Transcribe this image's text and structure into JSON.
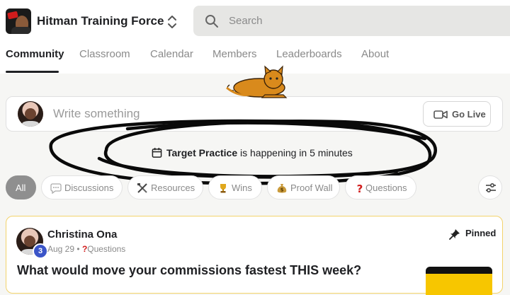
{
  "header": {
    "group_name": "Hitman Training Force",
    "search_placeholder": "Search"
  },
  "tabs": [
    {
      "label": "Community",
      "active": true
    },
    {
      "label": "Classroom",
      "active": false
    },
    {
      "label": "Calendar",
      "active": false
    },
    {
      "label": "Members",
      "active": false
    },
    {
      "label": "Leaderboards",
      "active": false
    },
    {
      "label": "About",
      "active": false
    }
  ],
  "composer": {
    "placeholder": "Write something",
    "go_live_label": "Go Live"
  },
  "event_banner": {
    "event_name": "Target Practice",
    "suffix": " is happening in 5 minutes"
  },
  "filters": [
    {
      "label": "All",
      "icon": "none",
      "selected": true
    },
    {
      "label": "Discussions",
      "icon": "speech-bubble-icon",
      "selected": false
    },
    {
      "label": "Resources",
      "icon": "tools-icon",
      "selected": false
    },
    {
      "label": "Wins",
      "icon": "trophy-icon",
      "selected": false
    },
    {
      "label": "Proof Wall",
      "icon": "money-bag-icon",
      "selected": false
    },
    {
      "label": "Questions",
      "icon": "question-mark-icon",
      "selected": false
    }
  ],
  "post": {
    "author": "Christina Ona",
    "level": "3",
    "date": "Aug 29",
    "separator": "•",
    "category": "Questions",
    "pinned_label": "Pinned",
    "title": "What would move your commissions fastest THIS week?"
  },
  "colors": {
    "accent_yellow": "#f3d36b",
    "level_badge": "#3b55c8",
    "question_red": "#d11c1c",
    "chip_selected": "#8f8f8f",
    "search_bg": "#e6e6e4"
  }
}
